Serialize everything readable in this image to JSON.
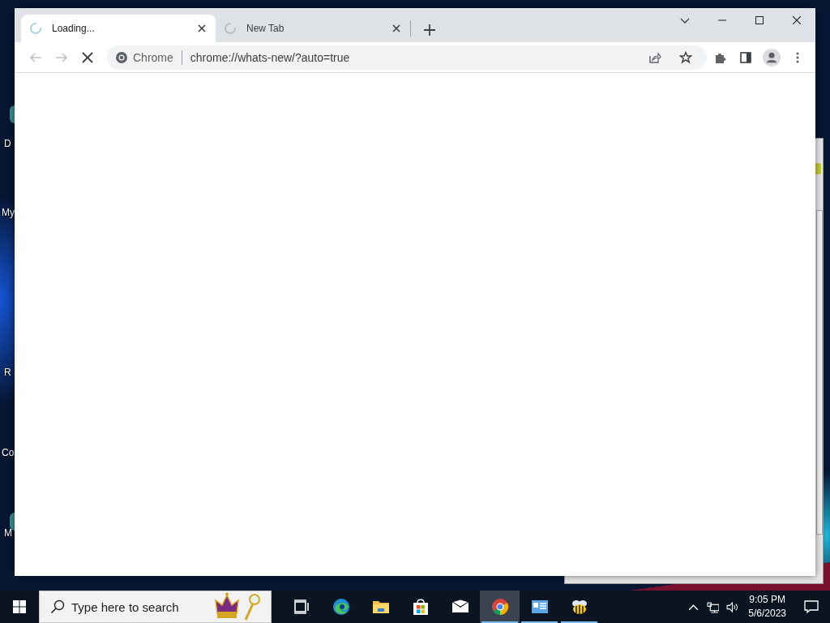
{
  "desktop": {
    "icons": [
      {
        "label": "D"
      },
      {
        "label": "My"
      },
      {
        "label": "R"
      },
      {
        "label": "Co"
      },
      {
        "label": "M"
      }
    ]
  },
  "browser": {
    "tabs": [
      {
        "title": "Loading...",
        "selected": true,
        "loading": true
      },
      {
        "title": "New Tab",
        "selected": false,
        "loading": true
      }
    ],
    "nav": [
      {
        "kind": "back",
        "disabled": true
      },
      {
        "kind": "forward",
        "disabled": true
      },
      {
        "kind": "stop",
        "disabled": false
      }
    ],
    "omnibox": {
      "chip": "Chrome",
      "url": "chrome://whats-new/?auto=true"
    }
  },
  "taskbar": {
    "search": {
      "placeholder": "Type here to search"
    },
    "apps": [
      {
        "kind": "task-view",
        "running": false,
        "selected": false
      },
      {
        "kind": "edge",
        "running": false,
        "selected": false
      },
      {
        "kind": "explorer",
        "running": false,
        "selected": false
      },
      {
        "kind": "store",
        "running": false,
        "selected": false
      },
      {
        "kind": "mail",
        "running": false,
        "selected": false
      },
      {
        "kind": "chrome",
        "running": true,
        "selected": true
      },
      {
        "kind": "control-panel",
        "running": true,
        "selected": false
      },
      {
        "kind": "bee",
        "running": true,
        "selected": false
      }
    ],
    "clock": {
      "time": "9:05 PM",
      "date": "5/6/2023"
    }
  }
}
